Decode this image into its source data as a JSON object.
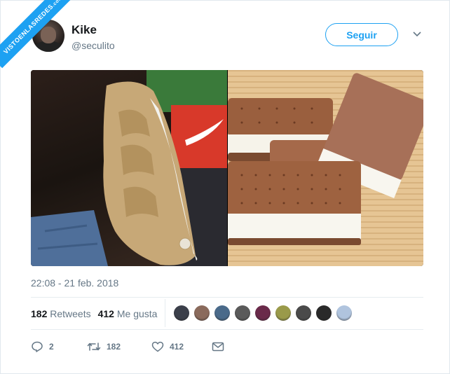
{
  "watermark": {
    "text": "VISTOENLASREDES",
    "suffix": ".com"
  },
  "user": {
    "name": "Kike",
    "handle": "@seculito"
  },
  "follow_button": {
    "label": "Seguir"
  },
  "images": [
    {
      "description": "Nike Air More Uptempo sneaker, tan/wheat with white sole, next to Nike shoe box"
    },
    {
      "description": "Ice cream sandwiches with brown wafers and white vanilla filling on bamboo mat"
    }
  ],
  "timestamp": "22:08 - 21 feb. 2018",
  "stats": {
    "retweets_count": "182",
    "retweets_label": "Retweets",
    "likes_count": "412",
    "likes_label": "Me gusta"
  },
  "liker_avatars": [
    "#3b3f4a",
    "#8a6a5c",
    "#4a6a8a",
    "#5a5a5a",
    "#6a2a4a",
    "#9a9a4a",
    "#4a4a4a",
    "#2a2a2a",
    "#b0c4de"
  ],
  "actions": {
    "replies": "2",
    "retweets": "182",
    "likes": "412"
  },
  "colors": {
    "accent": "#1da1f2",
    "muted": "#657786"
  }
}
